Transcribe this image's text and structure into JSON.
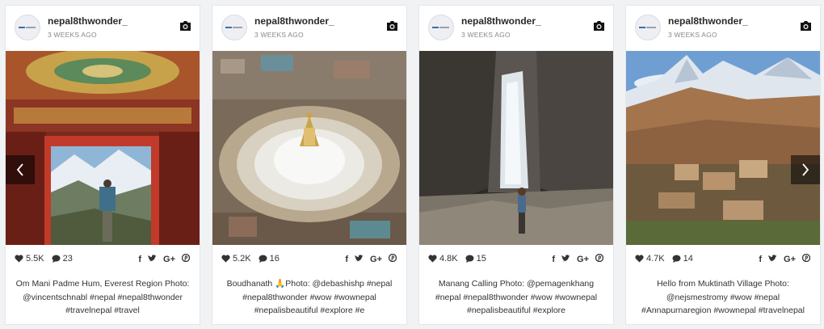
{
  "accent": "#2a2a2a",
  "posts": [
    {
      "username": "nepal8thwonder_",
      "time_ago": "3 WEEKS AGO",
      "likes": "5.5K",
      "comments": "23",
      "caption": "Om Mani Padme Hum, Everest Region Photo: @vincentschnabl #nepal #nepal8thwonder #travelnepal #travel"
    },
    {
      "username": "nepal8thwonder_",
      "time_ago": "3 WEEKS AGO",
      "likes": "5.2K",
      "comments": "16",
      "caption": "Boudhanath 🙏Photo: @debashishp #nepal #nepal8thwonder #wow #wownepal #nepalisbeautiful #explore #e"
    },
    {
      "username": "nepal8thwonder_",
      "time_ago": "3 WEEKS AGO",
      "likes": "4.8K",
      "comments": "15",
      "caption": "Manang Calling Photo: @pemagenkhang #nepal #nepal8thwonder #wow #wownepal #nepalisbeautiful #explore"
    },
    {
      "username": "nepal8thwonder_",
      "time_ago": "3 WEEKS AGO",
      "likes": "4.7K",
      "comments": "14",
      "caption": "Hello from Muktinath Village Photo: @nejsmestromy #wow #nepal #Annapurnaregion #wownepal #travelnepal"
    }
  ],
  "share_icons": [
    "facebook-icon",
    "twitter-icon",
    "google-plus-icon",
    "pinterest-icon"
  ],
  "share_labels": {
    "facebook": "f",
    "google_plus": "G+"
  },
  "nav": {
    "prev": "chevron-left-icon",
    "next": "chevron-right-icon"
  }
}
